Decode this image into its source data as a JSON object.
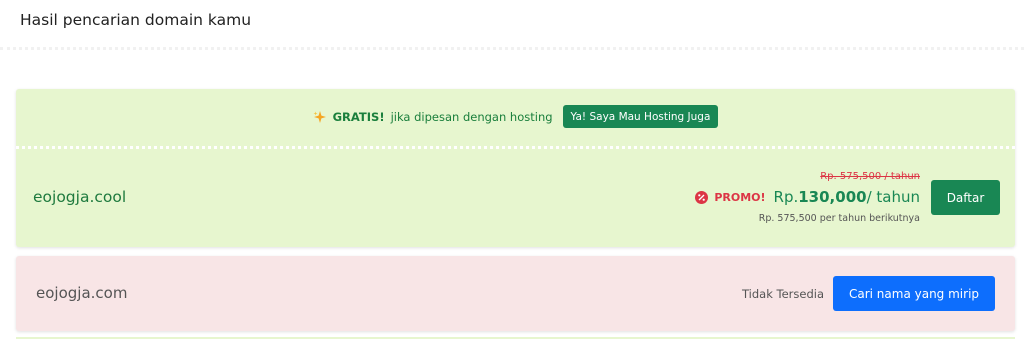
{
  "header": {
    "title": "Hasil pencarian domain kamu"
  },
  "available_card": {
    "promo_bar": {
      "gratis_label": "GRATIS!",
      "message": "jika dipesan dengan hosting",
      "hosting_button_label": "Ya! Saya Mau Hosting Juga"
    },
    "domain": "eojogja.cool",
    "old_price": "Rp. 575,500 / tahun",
    "promo_label": "PROMO!",
    "price_prefix": "Rp.",
    "price_amount": "130,000",
    "price_suffix": "/ tahun",
    "renewal_note": "Rp. 575,500 per tahun berikutnya",
    "register_button_label": "Daftar"
  },
  "unavailable_card": {
    "domain": "eojogja.com",
    "status": "Tidak Tersedia",
    "similar_button_label": "Cari nama yang mirip"
  },
  "colors": {
    "available_bg": "#e7f6cf",
    "unavailable_bg": "#f8e5e6",
    "success": "#198754",
    "danger": "#dc3545",
    "primary": "#0d6efd"
  },
  "icons": {
    "sparkle": "sparkle-icon",
    "promo": "percent-icon"
  }
}
